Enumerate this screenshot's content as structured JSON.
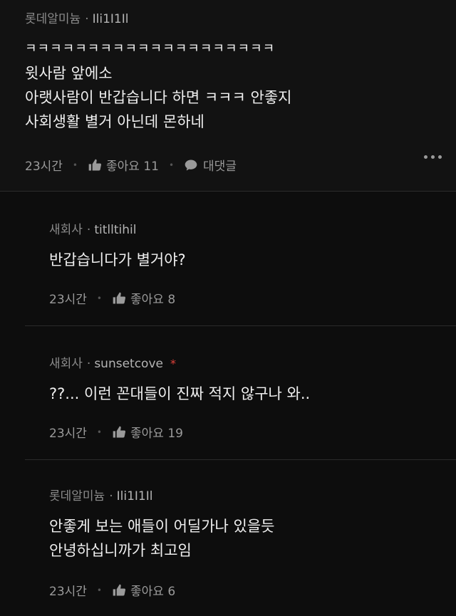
{
  "comments": [
    {
      "badge": "롯데알미늄",
      "user": "Ili1I1Il",
      "lines": [
        "ㅋㅋㅋㅋㅋㅋㅋㅋㅋㅋㅋㅋㅋㅋㅋㅋㅋㅋㅋㅋ",
        "윗사람 앞에소",
        "아랫사람이 반갑습니다 하면 ㅋㅋㅋ 안좋지",
        "사회생활 별거 아닌데 몬하네"
      ],
      "time": "23시간",
      "like_label": "좋아요 11",
      "reply_label": "대댓글"
    },
    {
      "badge": "새회사",
      "user": "titlltihil",
      "lines": [
        "반갑습니다가 별거야?"
      ],
      "time": "23시간",
      "like_label": "좋아요 8"
    },
    {
      "badge": "새회사",
      "user": "sunsetcove",
      "star": "*",
      "lines": [
        "??... 이런 꼰대들이 진짜 적지 않구나 와.."
      ],
      "time": "23시간",
      "like_label": "좋아요 19"
    },
    {
      "badge": "롯데알미늄",
      "user": "Ili1I1Il",
      "lines": [
        "안좋게 보는 애들이 어딜가나 있을듯",
        "안녕하십니까가 최고임"
      ],
      "time": "23시간",
      "like_label": "좋아요 6"
    }
  ],
  "icons": {
    "like": "thumbs-up-icon",
    "reply": "speech-bubble-icon",
    "more": "more-dots-icon"
  },
  "colors": {
    "background": "#0d0d0d",
    "main_comment_bg": "#121212",
    "star": "#e0413a"
  }
}
